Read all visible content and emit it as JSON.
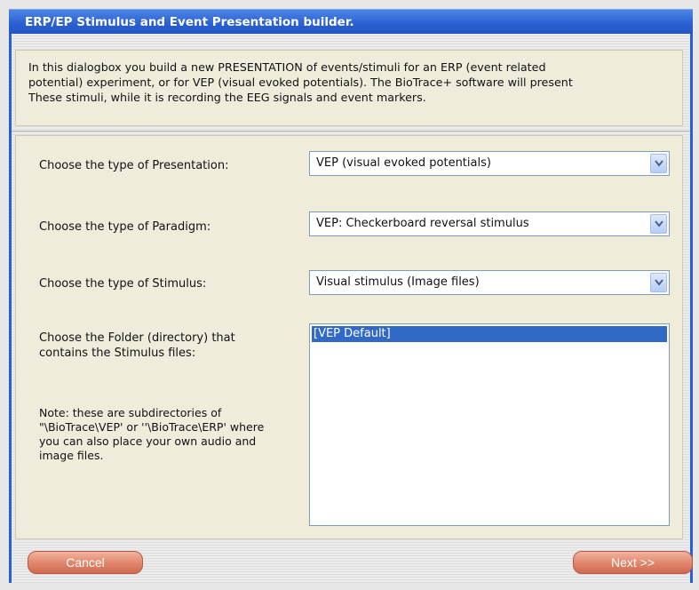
{
  "dialog": {
    "title": "ERP/EP Stimulus and Event Presentation builder.",
    "intro_line1": "In this dialogbox you build a new PRESENTATION of events/stimuli for an ERP (event related",
    "intro_line2": "potential) experiment, or for VEP (visual evoked potentials). The BioTrace+ software will present",
    "intro_line3": "These stimuli, while it is recording the EEG signals and event markers."
  },
  "form": {
    "presentation_label": "Choose the type of Presentation:",
    "presentation_value": "VEP (visual evoked potentials)",
    "paradigm_label": "Choose the type of Paradigm:",
    "paradigm_value": "VEP: Checkerboard reversal stimulus",
    "stimulus_label": "Choose the type of Stimulus:",
    "stimulus_value": "Visual stimulus (Image files)",
    "folder_label_line1": "Choose the Folder (directory) that",
    "folder_label_line2": "contains the Stimulus files:",
    "folders": [
      "[VEP Default]"
    ],
    "note_line1": "Note: these are subdirectories of",
    "note_line2": "\"\\BioTrace\\VEP' or ''\\BioTrace\\ERP' where",
    "note_line3": "you can also place your own audio and",
    "note_line4": "image files."
  },
  "buttons": {
    "cancel": "Cancel",
    "next": "Next >>"
  },
  "colors": {
    "titlebar": "#2a5fd0",
    "panel": "#efecdc",
    "button": "#e0856a",
    "selection": "#3169c6"
  }
}
